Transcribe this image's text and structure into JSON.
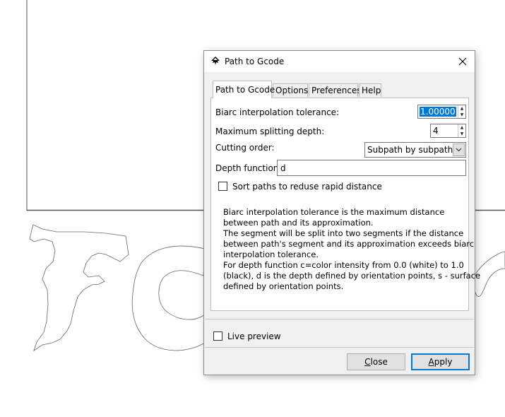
{
  "dialog": {
    "title": "Path to Gcode",
    "tabs": [
      {
        "label": "Path to Gcode",
        "active": true
      },
      {
        "label": "Options"
      },
      {
        "label": "Preferences"
      },
      {
        "label": "Help"
      }
    ],
    "fields": {
      "biarc_label": "Biarc interpolation tolerance:",
      "biarc_value": "1.00000",
      "depth_label": "Maximum splitting depth:",
      "depth_value": "4",
      "cutting_label": "Cutting order:",
      "cutting_value": "Subpath by subpath",
      "depth_function_label": "Depth function:",
      "depth_function_value": "d"
    },
    "sort_paths": {
      "label": "Sort paths to reduse rapid distance",
      "checked": false
    },
    "help_lines": [
      "Biarc interpolation tolerance is the maximum distance",
      "between path and its approximation.",
      "The segment will be split into two segments if the distance",
      "between path's segment and its approximation exceeds biarc",
      "interpolation tolerance.",
      "For depth function c=color intensity from 0.0 (white) to 1.0",
      "(black), d is the depth defined by orientation points, s - surface",
      "defined by orientation points."
    ],
    "live_preview": {
      "label": "Live preview",
      "checked": false
    },
    "buttons": {
      "close_first": "C",
      "close_rest": "lose",
      "apply_first": "A",
      "apply_rest": "pply"
    }
  },
  "icons": {
    "app": "inkscape-icon",
    "close": "close-icon",
    "dropdown": "chevron-down-icon",
    "spin": "spin-arrows-icon"
  },
  "colors": {
    "selection": "#0078d7",
    "dialog_bg": "#f0f0f0",
    "canvas_stroke": "#555555"
  }
}
